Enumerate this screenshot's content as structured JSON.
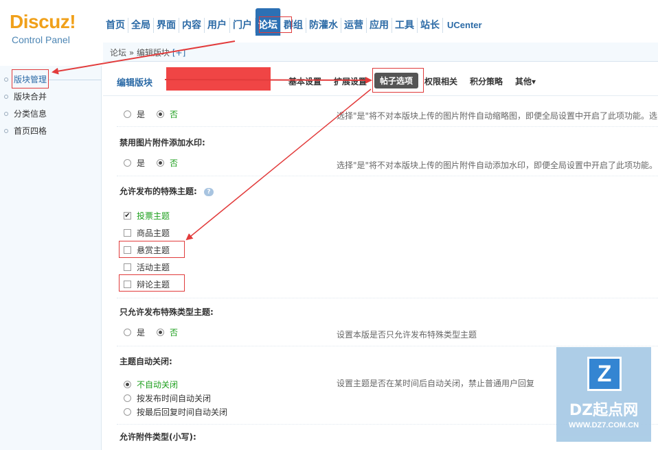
{
  "logo": {
    "main": "Discuz!",
    "sub": "Control Panel"
  },
  "topnav": [
    "首页",
    "全局",
    "界面",
    "内容",
    "用户",
    "门户",
    "论坛",
    "群组",
    "防灌水",
    "运营",
    "应用",
    "工具",
    "站长",
    "UCenter"
  ],
  "topnav_active_index": 6,
  "breadcrumb": {
    "root": "论坛",
    "sep": "»",
    "page": "编辑版块",
    "plus": "[+]"
  },
  "sidebar": {
    "items": [
      "版块管理",
      "版块合并",
      "分类信息",
      "首页四格"
    ],
    "active_index": 0
  },
  "tabs": {
    "title": "编辑版块",
    "items": [
      "基本设置",
      "扩展设置",
      "帖子选项",
      "权限相关",
      "积分策略",
      "其他▾"
    ],
    "active_index": 2
  },
  "sections": {
    "autothumb": {
      "yes": "是",
      "no": "否",
      "desc": "选择\"是\"将不对本版块上传的图片附件自动缩略图，即便全局设置中开启了此项功能。选"
    },
    "watermark": {
      "title": "禁用图片附件添加水印:",
      "yes": "是",
      "no": "否",
      "desc": "选择\"是\"将不对本版块上传的图片附件自动添加水印，即便全局设置中开启了此项功能。"
    },
    "special": {
      "title": "允许发布的特殊主题:",
      "options": [
        "投票主题",
        "商品主题",
        "悬赏主题",
        "活动主题",
        "辩论主题"
      ]
    },
    "onlyspecial": {
      "title": "只允许发布特殊类型主题:",
      "yes": "是",
      "no": "否",
      "desc": "设置本版是否只允许发布特殊类型主题"
    },
    "autoclose": {
      "title": "主题自动关闭:",
      "options": [
        "不自动关闭",
        "按发布时间自动关闭",
        "按最后回复时间自动关闭"
      ],
      "desc": "设置主题是否在某时间后自动关闭，禁止普通用户回复"
    },
    "attachtypes": {
      "title": "允许附件类型(小写):"
    }
  },
  "watermark_logo": {
    "mark": "Z",
    "name": "DZ起点网",
    "url": "WWW.DZ7.COM.CN"
  },
  "colors": {
    "link": "#2b6aa6",
    "accent": "#f0a01a",
    "highlight": "#e03a3a",
    "green": "#1b9e1b"
  }
}
